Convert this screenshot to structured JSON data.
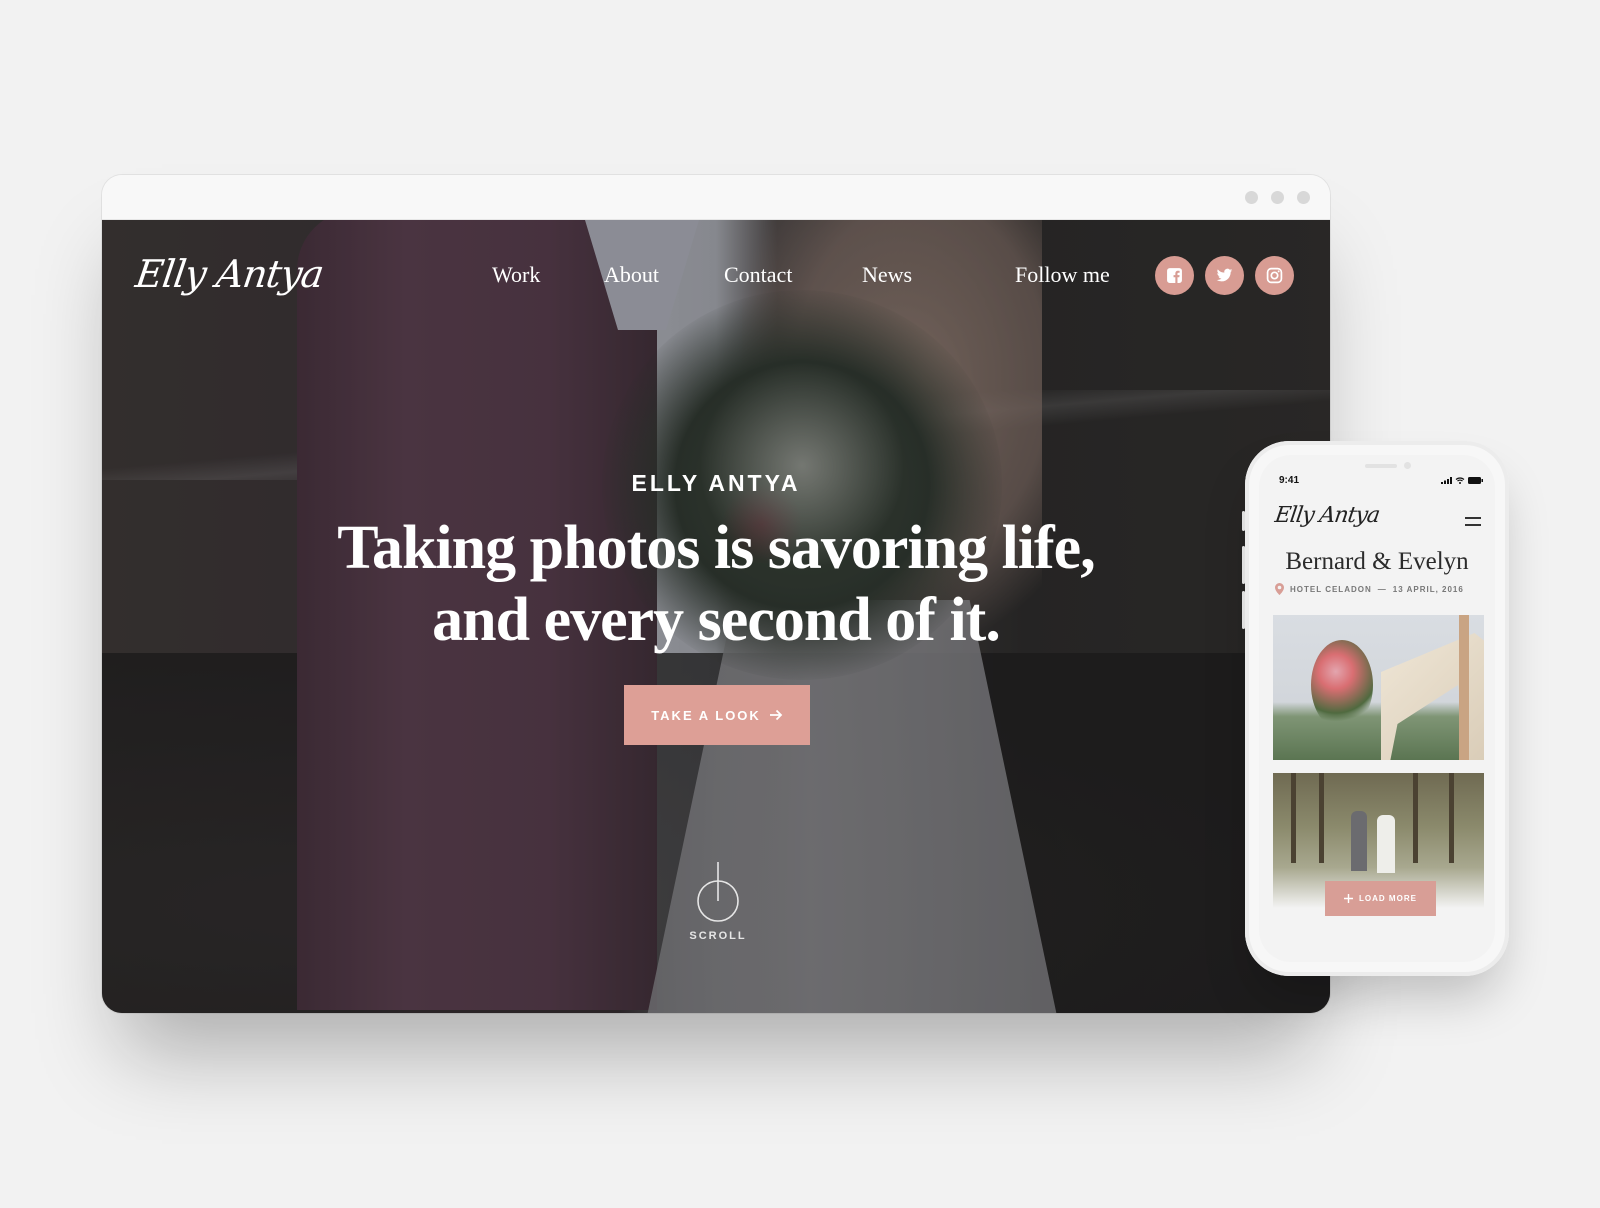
{
  "desktop": {
    "logo": "Elly Antya",
    "nav": [
      {
        "label": "Work"
      },
      {
        "label": "About"
      },
      {
        "label": "Contact"
      },
      {
        "label": "News"
      }
    ],
    "follow_label": "Follow me",
    "social": [
      {
        "name": "facebook",
        "icon": "facebook-icon"
      },
      {
        "name": "twitter",
        "icon": "twitter-icon"
      },
      {
        "name": "instagram",
        "icon": "instagram-icon"
      }
    ],
    "hero": {
      "eyebrow": "ELLY ANTYA",
      "headline_line1": "Taking photos is savoring life,",
      "headline_line2": "and every second of it.",
      "cta_label": "TAKE A LOOK",
      "cta_icon": "arrow-right-icon",
      "scroll_label": "SCROLL",
      "scroll_icon": "scroll-indicator-icon"
    }
  },
  "mobile": {
    "status_time": "9:41",
    "logo": "Elly Antya",
    "menu_icon": "hamburger-menu-icon",
    "title": "Bernard & Evelyn",
    "location": "HOTEL CELADON",
    "separator": "—",
    "date": "13 APRIL, 2016",
    "location_icon": "map-pin-icon",
    "load_more_label": "LOAD MORE",
    "load_more_icon": "plus-icon"
  },
  "colors": {
    "accent": "#dd9f96",
    "background": "#f2f2f2",
    "text_light": "#ffffff",
    "text_dark": "#2b2b2b"
  }
}
